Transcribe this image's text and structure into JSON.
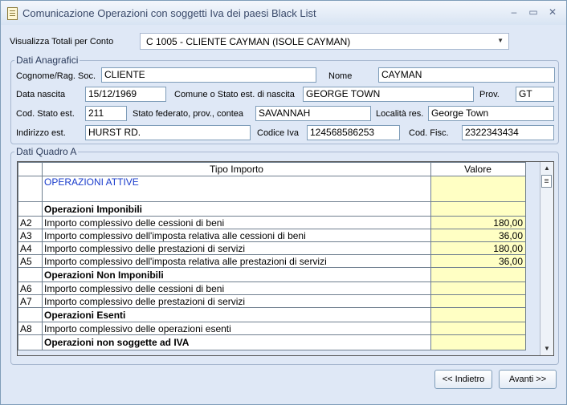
{
  "window": {
    "title": "Comunicazione Operazioni con soggetti Iva dei paesi Black List",
    "minimize": "–",
    "maximize": "▭",
    "close": "✕"
  },
  "visualizza": {
    "label": "Visualizza Totali per Conto",
    "value": "C  1005 - CLIENTE CAYMAN (ISOLE CAYMAN)"
  },
  "anagrafica": {
    "group_title": "Dati Anagrafici",
    "cognome_label": "Cognome/Rag. Soc.",
    "cognome": "CLIENTE",
    "nome_label": "Nome",
    "nome": "CAYMAN",
    "data_nascita_label": "Data nascita",
    "data_nascita": "15/12/1969",
    "comune_label": "Comune o Stato est. di nascita",
    "comune": "GEORGE TOWN",
    "prov_label": "Prov.",
    "prov": "GT",
    "cod_stato_label": "Cod. Stato est.",
    "cod_stato": "211",
    "stato_fed_label": "Stato federato, prov., contea",
    "stato_fed": "SAVANNAH",
    "localita_label": "Località res.",
    "localita": "George Town",
    "indirizzo_label": "Indirizzo est.",
    "indirizzo": "HURST RD.",
    "codice_iva_label": "Codice Iva",
    "codice_iva": "124568586253",
    "cod_fisc_label": "Cod. Fisc.",
    "cod_fisc": "2322343434"
  },
  "quadro": {
    "group_title": "Dati Quadro A",
    "col_tipo": "Tipo Importo",
    "col_valore": "Valore",
    "rows": [
      {
        "code": "",
        "desc": "OPERAZIONI ATTIVE",
        "value": ""
      },
      {
        "code": "",
        "desc": "Operazioni Imponibili",
        "value": ""
      },
      {
        "code": "A2",
        "desc": "Importo complessivo delle cessioni di beni",
        "value": "180,00"
      },
      {
        "code": "A3",
        "desc": "Importo complessivo dell'imposta relativa alle cessioni di beni",
        "value": "36,00"
      },
      {
        "code": "A4",
        "desc": "Importo complessivo delle prestazioni di servizi",
        "value": "180,00"
      },
      {
        "code": "A5",
        "desc": "Importo complessivo dell'imposta relativa alle prestazioni di servizi",
        "value": "36,00"
      },
      {
        "code": "",
        "desc": "Operazioni Non Imponibili",
        "value": ""
      },
      {
        "code": "A6",
        "desc": "Importo complessivo delle cessioni di beni",
        "value": ""
      },
      {
        "code": "A7",
        "desc": "Importo complessivo delle prestazioni di servizi",
        "value": ""
      },
      {
        "code": "",
        "desc": "Operazioni Esenti",
        "value": ""
      },
      {
        "code": "A8",
        "desc": "Importo complessivo delle operazioni esenti",
        "value": ""
      },
      {
        "code": "",
        "desc": "Operazioni non soggette ad IVA",
        "value": ""
      }
    ]
  },
  "buttons": {
    "indietro": "<< Indietro",
    "avanti": "Avanti >>"
  },
  "colors": {
    "window_bg": "#dfe8f6",
    "value_cell": "#ffffc4",
    "section_link": "#1a3ccc"
  }
}
